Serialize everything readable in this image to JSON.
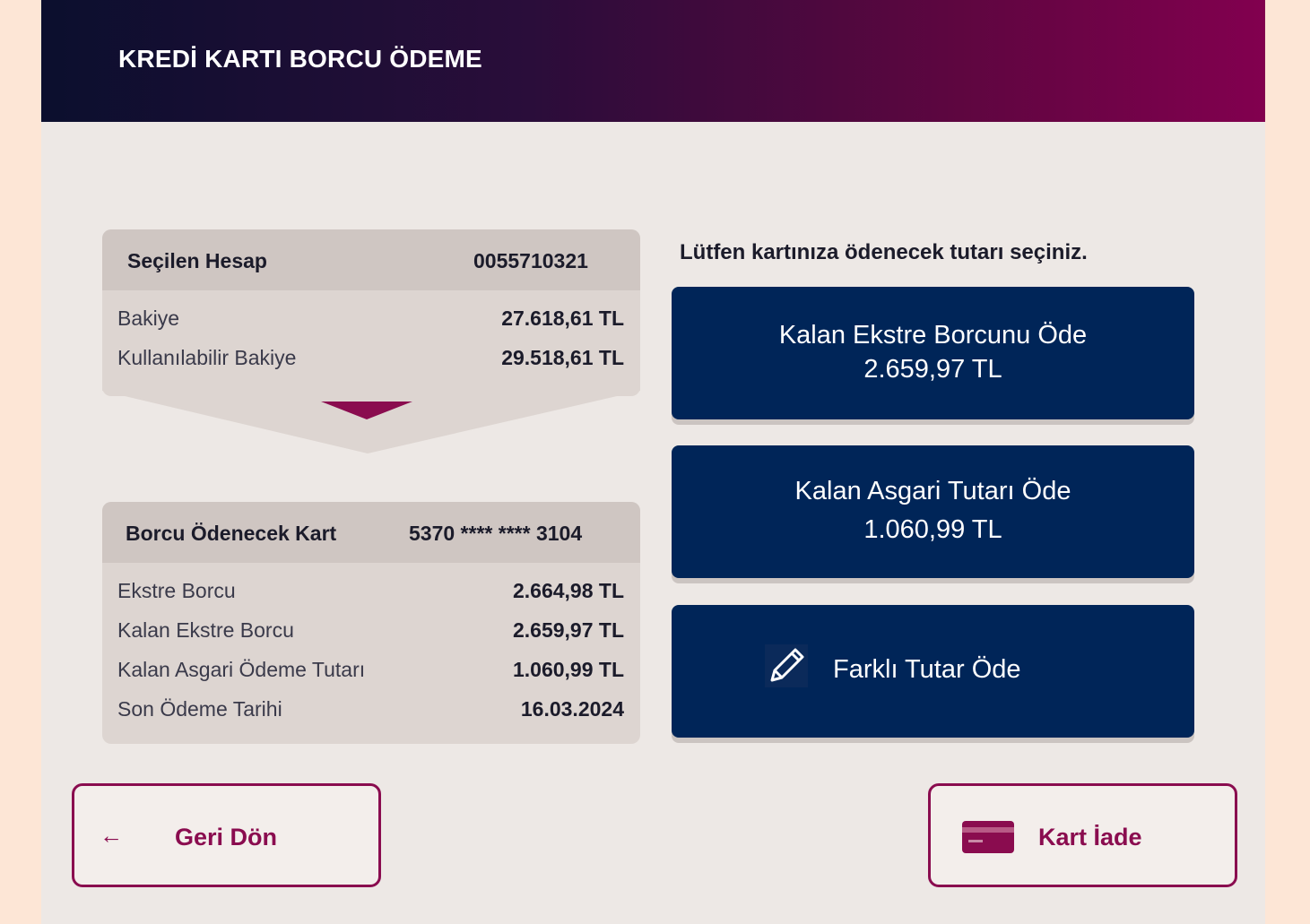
{
  "header": {
    "title": "KREDİ KARTI BORCU ÖDEME"
  },
  "account": {
    "title": "Seçilen Hesap",
    "number": "0055710321",
    "rows": [
      {
        "label": "Bakiye",
        "value": "27.618,61 TL"
      },
      {
        "label": "Kullanılabilir Bakiye",
        "value": "29.518,61 TL"
      }
    ]
  },
  "card": {
    "title": "Borcu Ödenecek Kart",
    "number": "5370 **** **** 3104",
    "rows": [
      {
        "label": "Ekstre Borcu",
        "value": "2.664,98 TL"
      },
      {
        "label": "Kalan Ekstre Borcu",
        "value": "2.659,97 TL"
      },
      {
        "label": "Kalan Asgari Ödeme Tutarı",
        "value": "1.060,99 TL"
      },
      {
        "label": "Son Ödeme Tarihi",
        "value": "16.03.2024"
      }
    ]
  },
  "instruction": "Lütfen kartınıza ödenecek tutarı seçiniz.",
  "options": [
    {
      "label": "Kalan Ekstre Borcunu Öde",
      "amount": "2.659,97 TL"
    },
    {
      "label": "Kalan Asgari Tutarı Öde",
      "amount": "1.060,99 TL"
    },
    {
      "label": "Farklı Tutar Öde",
      "icon": "pencil-icon"
    }
  ],
  "nav": {
    "back_label": "Geri Dön",
    "back_icon": "arrow-left-icon",
    "return_card_label": "Kart İade",
    "return_card_icon": "credit-card-icon"
  },
  "colors": {
    "navy": "#002558",
    "accent": "#8a0c4f",
    "background": "#ede8e5"
  }
}
